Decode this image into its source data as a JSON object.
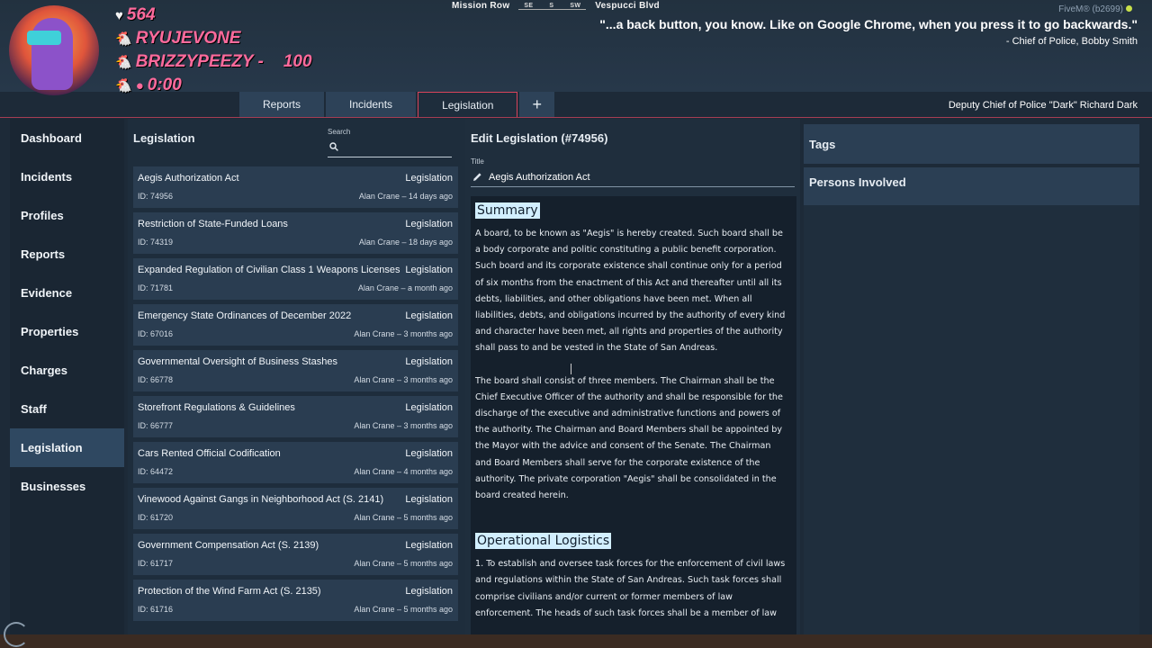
{
  "hud": {
    "street_left": "Mission Row",
    "street_right": "Vespucci Blvd",
    "compass": [
      "SE",
      "S",
      "SW"
    ],
    "server": "FiveM® (b2699)",
    "stats": [
      {
        "icon": "heart-icon",
        "text": "564"
      },
      {
        "icon": "chicken-icon",
        "text": "RYUJEVONE"
      },
      {
        "icon": "chicken-icon",
        "text": "BRIZZYPEEZY -"
      },
      {
        "icon": "timer-icon",
        "text": "0:00"
      }
    ],
    "stat_extra": "100",
    "quote": "\"...a back button, you know. Like on Google Chrome, when you press it to go backwards.\"",
    "quote_author": "- Chief of Police, Bobby Smith"
  },
  "tabs": [
    {
      "label": "Reports",
      "active": false
    },
    {
      "label": "Incidents",
      "active": false
    },
    {
      "label": "Legislation",
      "active": true
    }
  ],
  "tab_add_label": "+",
  "officer": "Deputy Chief of Police \"Dark\" Richard Dark",
  "sidebar": {
    "items": [
      {
        "label": "Dashboard"
      },
      {
        "label": "Incidents"
      },
      {
        "label": "Profiles"
      },
      {
        "label": "Reports"
      },
      {
        "label": "Evidence"
      },
      {
        "label": "Properties"
      },
      {
        "label": "Charges"
      },
      {
        "label": "Staff"
      },
      {
        "label": "Legislation",
        "active": true
      },
      {
        "label": "Businesses"
      }
    ]
  },
  "list": {
    "title": "Legislation",
    "search_label": "Search",
    "search_value": "",
    "rows": [
      {
        "title": "Aegis Authorization Act",
        "type": "Legislation",
        "id": "ID: 74956",
        "meta": "Alan Crane – 14 days ago"
      },
      {
        "title": "Restriction of State-Funded Loans",
        "type": "Legislation",
        "id": "ID: 74319",
        "meta": "Alan Crane – 18 days ago"
      },
      {
        "title": "Expanded Regulation of Civilian Class 1 Weapons Licenses",
        "type": "Legislation",
        "id": "ID: 71781",
        "meta": "Alan Crane – a month ago"
      },
      {
        "title": "Emergency State Ordinances of December 2022",
        "type": "Legislation",
        "id": "ID: 67016",
        "meta": "Alan Crane – 3 months ago"
      },
      {
        "title": "Governmental Oversight of Business Stashes",
        "type": "Legislation",
        "id": "ID: 66778",
        "meta": "Alan Crane – 3 months ago"
      },
      {
        "title": "Storefront Regulations & Guidelines",
        "type": "Legislation",
        "id": "ID: 66777",
        "meta": "Alan Crane – 3 months ago"
      },
      {
        "title": "Cars Rented Official Codification",
        "type": "Legislation",
        "id": "ID: 64472",
        "meta": "Alan Crane – 4 months ago"
      },
      {
        "title": "Vinewood Against Gangs in Neighborhood Act (S. 2141)",
        "type": "Legislation",
        "id": "ID: 61720",
        "meta": "Alan Crane – 5 months ago"
      },
      {
        "title": "Government Compensation Act (S. 2139)",
        "type": "Legislation",
        "id": "ID: 61717",
        "meta": "Alan Crane – 5 months ago"
      },
      {
        "title": "Protection of the Wind Farm Act (S. 2135)",
        "type": "Legislation",
        "id": "ID: 61716",
        "meta": "Alan Crane – 5 months ago"
      }
    ]
  },
  "editor": {
    "heading": "Edit Legislation (#74956)",
    "title_label": "Title",
    "title_value": "Aegis Authorization Act",
    "summary_heading": "Summary",
    "summary_p1": "A board, to be known as \"Aegis\" is hereby created. Such board shall be a body corporate and politic constituting a public benefit corporation. Such board and its corporate existence shall continue only for a period of six months from the enactment of this Act and thereafter until all its debts, liabilities, and other obligations have been met. When all liabilities, debts, and obligations incurred by the authority of every kind and character have been met, all rights and properties of the authority shall pass to and be vested in the State of San Andreas.",
    "summary_p2": "The board shall consist of three members. The Chairman shall be the Chief Executive Officer of the authority and shall be responsible for the discharge of the executive and administrative functions and powers of the authority. The Chairman and Board Members shall be appointed by the Mayor with the advice and consent of the Senate.  The Chairman and Board Members shall serve for the corporate existence of the authority. The private corporation \"Aegis\" shall be consolidated in the board created herein.",
    "ops_heading": "Operational Logistics",
    "ops_p1": "1. To establish and oversee task forces for the enforcement of civil laws and regulations within the State of San Andreas.  Such task forces shall comprise civilians and/or current or former members of law enforcement.  The heads of such task forces shall be a member of law"
  },
  "right": {
    "tags_label": "Tags",
    "persons_label": "Persons Involved"
  },
  "colors": {
    "accent": "#c9425a",
    "panel": "#1e2d3c",
    "row": "#2a3d51",
    "highlight": "#d2efff",
    "stat_pink": "#ff6a9c"
  }
}
